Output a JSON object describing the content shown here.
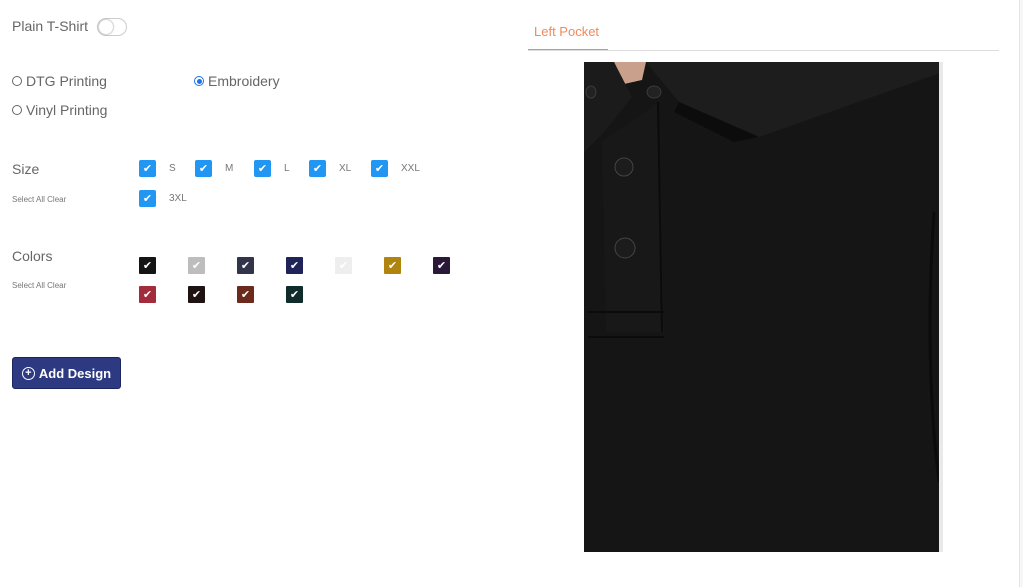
{
  "plain_tshirt": {
    "label": "Plain T-Shirt",
    "enabled": false
  },
  "printing": {
    "options": [
      {
        "label": "DTG Printing",
        "selected": false
      },
      {
        "label": "Embroidery",
        "selected": true
      },
      {
        "label": "Vinyl Printing",
        "selected": false
      }
    ]
  },
  "size": {
    "title": "Size",
    "select_all": "Select All",
    "clear": "Clear",
    "items": [
      {
        "label": "S",
        "checked": true
      },
      {
        "label": "M",
        "checked": true
      },
      {
        "label": "L",
        "checked": true
      },
      {
        "label": "XL",
        "checked": true
      },
      {
        "label": "XXL",
        "checked": true
      },
      {
        "label": "3XL",
        "checked": true
      }
    ]
  },
  "colors": {
    "title": "Colors",
    "select_all": "Select All",
    "clear": "Clear",
    "swatches": [
      {
        "hex": "#141414",
        "checked": true
      },
      {
        "hex": "#bdbdbd",
        "checked": true
      },
      {
        "hex": "#32344a",
        "checked": true
      },
      {
        "hex": "#1f2358",
        "checked": true
      },
      {
        "hex": "#eeeeee",
        "checked": true
      },
      {
        "hex": "#b0850f",
        "checked": true
      },
      {
        "hex": "#2a1838",
        "checked": true
      },
      {
        "hex": "#a22b3c",
        "checked": true
      },
      {
        "hex": "#1e1212",
        "checked": true
      },
      {
        "hex": "#6b2a1c",
        "checked": true
      },
      {
        "hex": "#0f2b2a",
        "checked": true
      }
    ]
  },
  "add_design": {
    "label": "Add Design",
    "icon": "plus-circle-icon"
  },
  "preview": {
    "tab_label": "Left Pocket",
    "garment_color": "#141414"
  },
  "theme": {
    "accent": "#f08a5d",
    "checkbox": "#2196f3",
    "button": "#2d3a82"
  }
}
